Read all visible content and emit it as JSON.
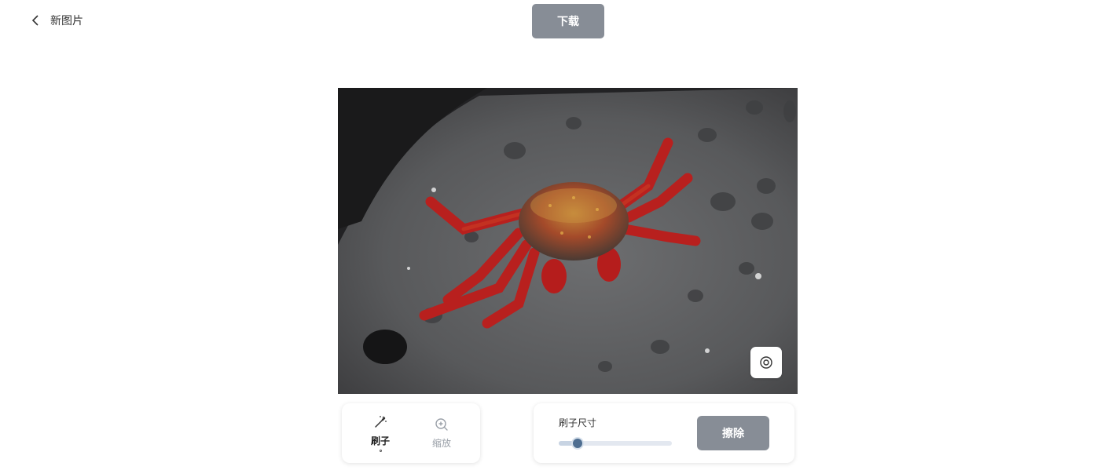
{
  "header": {
    "back_label": "新图片",
    "download_label": "下载"
  },
  "tools": {
    "brush_label": "刷子",
    "zoom_label": "缩放",
    "active_tool": "brush"
  },
  "brush_panel": {
    "size_label": "刷子尺寸",
    "size_fraction": 0.17,
    "erase_label": "擦除"
  },
  "colors": {
    "button_gray": "#878d96",
    "slider_thumb": "#4e6e91",
    "slider_track": "#e3e8f0"
  },
  "icons": {
    "back": "chevron-left-icon",
    "preview": "eye-icon",
    "brush": "magic-wand-icon",
    "zoom": "zoom-in-icon"
  }
}
